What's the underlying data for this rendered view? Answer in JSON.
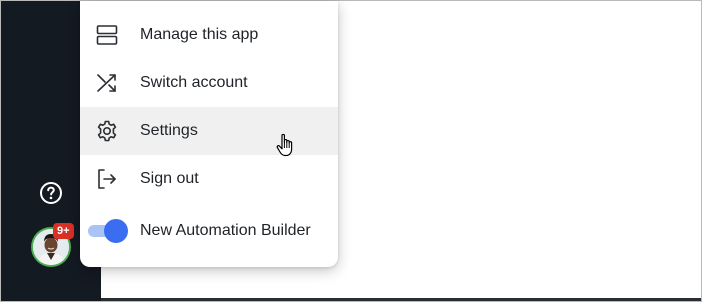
{
  "menu": {
    "items": [
      {
        "label": "Manage this app",
        "icon": "server-stack-icon"
      },
      {
        "label": "Switch account",
        "icon": "shuffle-icon"
      },
      {
        "label": "Settings",
        "icon": "gear-icon"
      },
      {
        "label": "Sign out",
        "icon": "sign-out-icon"
      }
    ],
    "toggle": {
      "label": "New Automation Builder",
      "on": true
    }
  },
  "sidebar": {
    "help_icon": "help-icon",
    "notification_badge": "9+"
  },
  "colors": {
    "sidebar_bg": "#141a22",
    "toggle_on": "#3b6df0",
    "badge": "#d93025",
    "avatar_ring": "#4caf50",
    "hover_bg": "#f0f0f0"
  }
}
